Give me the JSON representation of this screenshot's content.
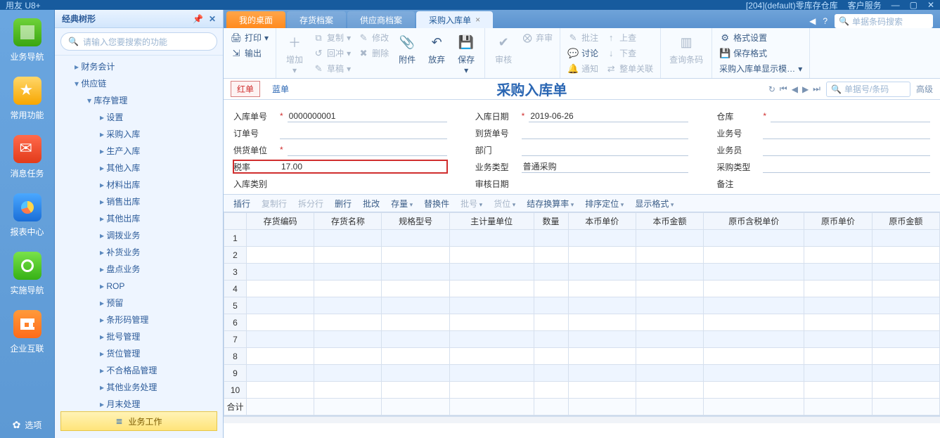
{
  "titlebar": {
    "left": "用友 U8+",
    "acct": "[204](default)零库存仓库",
    "svc": "客户服务"
  },
  "rail": [
    {
      "label": "业务导航",
      "ic": "ic-nav"
    },
    {
      "label": "常用功能",
      "ic": "ic-star"
    },
    {
      "label": "消息任务",
      "ic": "ic-msg"
    },
    {
      "label": "报表中心",
      "ic": "ic-rep"
    },
    {
      "label": "实施导航",
      "ic": "ic-comp"
    },
    {
      "label": "企业互联",
      "ic": "ic-ent"
    }
  ],
  "rail_options": "选项",
  "sidebar": {
    "head": "经典树形",
    "search_ph": "请输入您要搜索的功能",
    "items": [
      "财务会计",
      "供应链",
      "库存管理",
      "设置",
      "采购入库",
      "生产入库",
      "其他入库",
      "材料出库",
      "销售出库",
      "其他出库",
      "调拨业务",
      "补货业务",
      "盘点业务",
      "ROP",
      "预留",
      "条形码管理",
      "批号管理",
      "货位管理",
      "不合格品管理",
      "其他业务处理",
      "月末处理"
    ],
    "bottom_tab": "业务工作"
  },
  "tabs": {
    "t0": "我的桌面",
    "t1": "存货档案",
    "t2": "供应商档案",
    "t3": "采购入库单",
    "search_ph": "单据条码搜索"
  },
  "ribbon": {
    "print": "打印",
    "output": "输出",
    "add": "增加",
    "copy": "复制",
    "rewind": "回冲",
    "draft": "草稿",
    "modify": "修改",
    "delete": "删除",
    "attach": "附件",
    "abandon": "放弃",
    "save": "保存",
    "audit": "审核",
    "abandon_audit": "弃审",
    "batch_approve": "批注",
    "discuss": "讨论",
    "notify": "通知",
    "up": "上查",
    "down": "下查",
    "related": "整单关联",
    "barcode": "查询条码",
    "fmt": "格式设置",
    "savefmt": "保存格式",
    "template": "采购入库单显示模…"
  },
  "dochead": {
    "red": "红单",
    "blue": "蓝单",
    "title": "采购入库单",
    "search_ph": "单据号/条码",
    "adv": "高级"
  },
  "form": {
    "f1l": "入库单号",
    "f1r": "*",
    "f1v": "0000000001",
    "f2l": "入库日期",
    "f2r": "*",
    "f2v": "2019-06-26",
    "f3l": "仓库",
    "f3r": "*",
    "f3v": "",
    "f4l": "订单号",
    "f4v": "",
    "f5l": "到货单号",
    "f5v": "",
    "f6l": "业务号",
    "f6v": "",
    "f7l": "供货单位",
    "f7r": "*",
    "f7v": "",
    "f8l": "部门",
    "f8v": "",
    "f9l": "业务员",
    "f9v": "",
    "f10l": "税率",
    "f10v": "17.00",
    "f11l": "业务类型",
    "f11v": "普通采购",
    "f12l": "采购类型",
    "f12v": "",
    "f13l": "入库类别",
    "f13v": "",
    "f14l": "审核日期",
    "f14v": "",
    "f15l": "备注",
    "f15v": ""
  },
  "gridbar": [
    "插行",
    "复制行",
    "拆分行",
    "删行",
    "批改",
    "存量",
    "替换件",
    "批号",
    "货位",
    "结存换算率",
    "排序定位",
    "显示格式"
  ],
  "gridcols": [
    "存货编码",
    "存货名称",
    "规格型号",
    "主计量单位",
    "数量",
    "本币单价",
    "本币金额",
    "原币含税单价",
    "原币单价",
    "原币金额"
  ],
  "total_label": "合计"
}
